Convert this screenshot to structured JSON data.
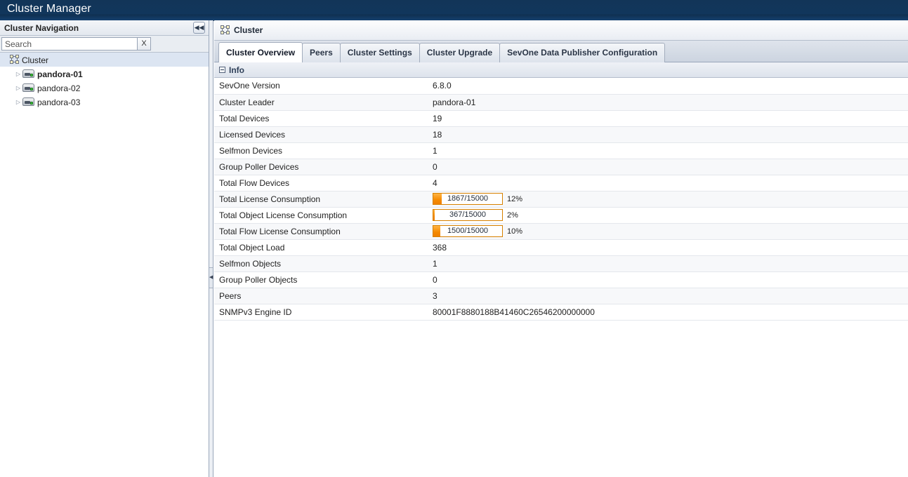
{
  "app": {
    "title": "Cluster Manager"
  },
  "sidebar": {
    "title": "Cluster Navigation",
    "collapse_icon": "collapse-left-icon",
    "collapse_glyph": "◀◀",
    "search": {
      "value": "",
      "placeholder": "Search",
      "clear_label": "X"
    },
    "tree": [
      {
        "label": "Cluster",
        "icon": "cluster-icon",
        "level": 0,
        "selected": true,
        "bold": false,
        "twisty": ""
      },
      {
        "label": "pandora-01",
        "icon": "server-icon",
        "level": 1,
        "selected": false,
        "bold": true,
        "twisty": "▷"
      },
      {
        "label": "pandora-02",
        "icon": "server-icon",
        "level": 1,
        "selected": false,
        "bold": false,
        "twisty": "▷"
      },
      {
        "label": "pandora-03",
        "icon": "server-icon",
        "level": 1,
        "selected": false,
        "bold": false,
        "twisty": "▷"
      }
    ]
  },
  "splitter": {
    "grip_glyph": "◀"
  },
  "content": {
    "breadcrumb": {
      "icon": "cluster-icon",
      "label": "Cluster"
    },
    "tabs": [
      {
        "label": "Cluster Overview",
        "active": true
      },
      {
        "label": "Peers",
        "active": false
      },
      {
        "label": "Cluster Settings",
        "active": false
      },
      {
        "label": "Cluster Upgrade",
        "active": false
      },
      {
        "label": "SevOne Data Publisher Configuration",
        "active": false
      }
    ],
    "section": {
      "title": "Info",
      "collapse_icon": "minus-box-icon",
      "expanded": true
    },
    "info_rows": [
      {
        "key": "SevOne Version",
        "type": "text",
        "value": "6.8.0"
      },
      {
        "key": "Cluster Leader",
        "type": "text",
        "value": "pandora-01"
      },
      {
        "key": "Total Devices",
        "type": "text",
        "value": "19"
      },
      {
        "key": "Licensed Devices",
        "type": "text",
        "value": "18"
      },
      {
        "key": "Selfmon Devices",
        "type": "text",
        "value": "1"
      },
      {
        "key": "Group Poller Devices",
        "type": "text",
        "value": "0"
      },
      {
        "key": "Total Flow Devices",
        "type": "text",
        "value": "4"
      },
      {
        "key": "Total License Consumption",
        "type": "meter",
        "value": "1867/15000",
        "used": 1867,
        "total": 15000,
        "percent": 12,
        "percent_label": "12%"
      },
      {
        "key": "Total Object License Consumption",
        "type": "meter",
        "value": "367/15000",
        "used": 367,
        "total": 15000,
        "percent": 2,
        "percent_label": "2%"
      },
      {
        "key": "Total Flow License Consumption",
        "type": "meter",
        "value": "1500/15000",
        "used": 1500,
        "total": 15000,
        "percent": 10,
        "percent_label": "10%"
      },
      {
        "key": "Total Object Load",
        "type": "text",
        "value": "368"
      },
      {
        "key": "Selfmon Objects",
        "type": "text",
        "value": "1"
      },
      {
        "key": "Group Poller Objects",
        "type": "text",
        "value": "0"
      },
      {
        "key": "Peers",
        "type": "text",
        "value": "3"
      },
      {
        "key": "SNMPv3 Engine ID",
        "type": "text",
        "value": "80001F8880188B41460C26546200000000"
      }
    ]
  },
  "colors": {
    "titlebar": "#123558",
    "accent_orange": "#ef8000",
    "meter_border": "#d78100",
    "selection": "#dce5f2",
    "section_text": "#2f4059"
  }
}
